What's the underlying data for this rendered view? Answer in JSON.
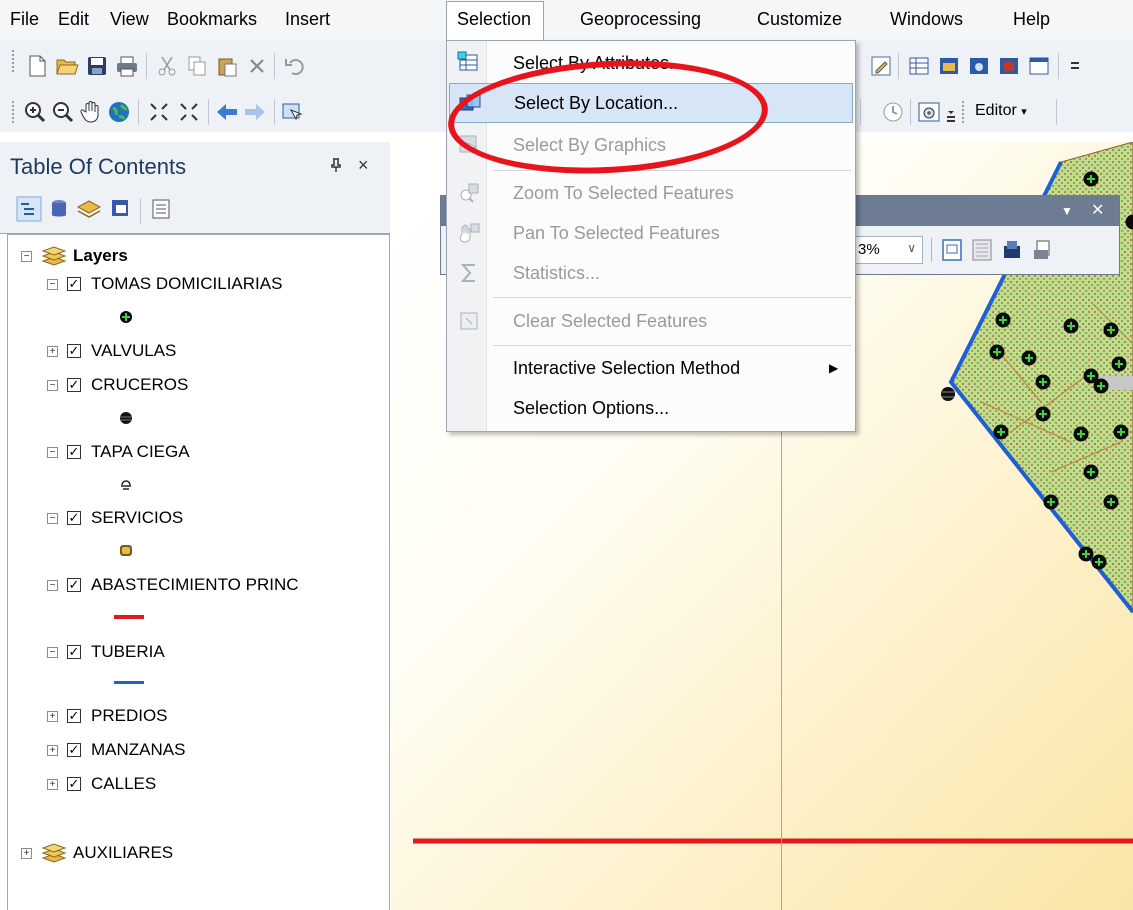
{
  "menubar": {
    "items": [
      "File",
      "Edit",
      "View",
      "Bookmarks",
      "Insert",
      "Selection",
      "Geoprocessing",
      "Customize",
      "Windows",
      "Help"
    ]
  },
  "selection_menu": {
    "items": [
      {
        "label": "Select By Attributes...",
        "icon": "select-attributes-icon",
        "disabled": false
      },
      {
        "label": "Select By Location...",
        "icon": "select-location-icon",
        "disabled": false,
        "highlighted": true
      },
      {
        "label": "Select By Graphics",
        "icon": "select-graphics-icon",
        "disabled": true
      },
      {
        "label": "Zoom To Selected Features",
        "icon": "zoom-selected-icon",
        "disabled": true
      },
      {
        "label": "Pan To Selected Features",
        "icon": "pan-selected-icon",
        "disabled": true
      },
      {
        "label": "Statistics...",
        "icon": "sigma-icon",
        "disabled": true
      },
      {
        "label": "Clear Selected Features",
        "icon": "clear-selection-icon",
        "disabled": true
      },
      {
        "label": "Interactive Selection Method",
        "icon": "",
        "disabled": false,
        "submenu": true
      },
      {
        "label": "Selection Options...",
        "icon": "",
        "disabled": false
      }
    ]
  },
  "toolbar": {
    "editor_label": "Editor",
    "zoom_fragment": "3%"
  },
  "toc": {
    "title": "Table Of Contents",
    "pin": "1",
    "close": "×",
    "root_group": "Layers",
    "layers": [
      {
        "name": "TOMAS DOMICILIARIAS",
        "expanded": true,
        "symbol": "green-point"
      },
      {
        "name": "VALVULAS",
        "expanded": false,
        "symbol": ""
      },
      {
        "name": "CRUCEROS",
        "expanded": true,
        "symbol": "black-point"
      },
      {
        "name": "TAPA CIEGA",
        "expanded": true,
        "symbol": "cap-point"
      },
      {
        "name": "SERVICIOS",
        "expanded": true,
        "symbol": "service-point"
      },
      {
        "name": "ABASTECIMIENTO PRINC",
        "expanded": true,
        "symbol": "red-line"
      },
      {
        "name": "TUBERIA",
        "expanded": true,
        "symbol": "blue-line"
      },
      {
        "name": "PREDIOS",
        "expanded": false,
        "symbol": ""
      },
      {
        "name": "MANZANAS",
        "expanded": false,
        "symbol": ""
      },
      {
        "name": "CALLES",
        "expanded": false,
        "symbol": ""
      }
    ],
    "aux_group": "AUXILIARES"
  },
  "colors": {
    "highlight_ring": "#e8131b",
    "menu_hover": "#d7e6f7",
    "tuberia_line": "#1f5fd6",
    "abastecimiento_line": "#e31a1c",
    "parcel_fill": "#b9e08a"
  }
}
